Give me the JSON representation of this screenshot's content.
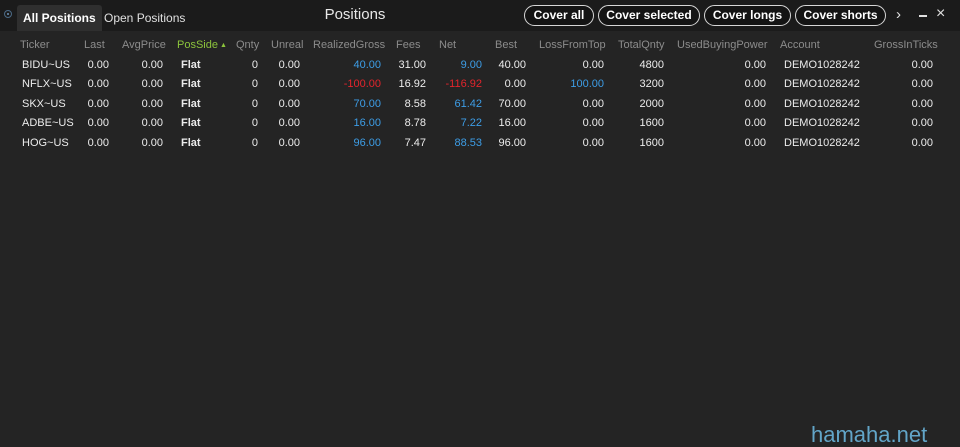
{
  "tabs": [
    "All Positions",
    "Open Positions"
  ],
  "window_title": "Positions",
  "buttons": [
    "Cover all",
    "Cover selected",
    "Cover longs",
    "Cover shorts"
  ],
  "columns": [
    "Ticker",
    "Last",
    "AvgPrice",
    "PosSide",
    "Qnty",
    "Unreal",
    "RealizedGross",
    "Fees",
    "Net",
    "Best",
    "LossFromTop",
    "TotalQnty",
    "UsedBuyingPower",
    "Account",
    "GrossInTicks"
  ],
  "sorted_column": "PosSide",
  "rows": [
    {
      "ticker": "BIDU~US",
      "last": "0.00",
      "avg_price": "0.00",
      "pos_side": "Flat",
      "qnty": "0",
      "unreal": "0.00",
      "realized_gross": "40.00",
      "fees": "31.00",
      "net": "9.00",
      "best": "40.00",
      "loss_from_top": "0.00",
      "total_qnty": "4800",
      "used_bp": "0.00",
      "account": "DEMO1028242",
      "gross_ticks": "0.00"
    },
    {
      "ticker": "NFLX~US",
      "last": "0.00",
      "avg_price": "0.00",
      "pos_side": "Flat",
      "qnty": "0",
      "unreal": "0.00",
      "realized_gross": "-100.00",
      "fees": "16.92",
      "net": "-116.92",
      "best": "0.00",
      "loss_from_top": "100.00",
      "total_qnty": "3200",
      "used_bp": "0.00",
      "account": "DEMO1028242",
      "gross_ticks": "0.00"
    },
    {
      "ticker": "SKX~US",
      "last": "0.00",
      "avg_price": "0.00",
      "pos_side": "Flat",
      "qnty": "0",
      "unreal": "0.00",
      "realized_gross": "70.00",
      "fees": "8.58",
      "net": "61.42",
      "best": "70.00",
      "loss_from_top": "0.00",
      "total_qnty": "2000",
      "used_bp": "0.00",
      "account": "DEMO1028242",
      "gross_ticks": "0.00"
    },
    {
      "ticker": "ADBE~US",
      "last": "0.00",
      "avg_price": "0.00",
      "pos_side": "Flat",
      "qnty": "0",
      "unreal": "0.00",
      "realized_gross": "16.00",
      "fees": "8.78",
      "net": "7.22",
      "best": "16.00",
      "loss_from_top": "0.00",
      "total_qnty": "1600",
      "used_bp": "0.00",
      "account": "DEMO1028242",
      "gross_ticks": "0.00"
    },
    {
      "ticker": "HOG~US",
      "last": "0.00",
      "avg_price": "0.00",
      "pos_side": "Flat",
      "qnty": "0",
      "unreal": "0.00",
      "realized_gross": "96.00",
      "fees": "7.47",
      "net": "88.53",
      "best": "96.00",
      "loss_from_top": "0.00",
      "total_qnty": "1600",
      "used_bp": "0.00",
      "account": "DEMO1028242",
      "gross_ticks": "0.00"
    }
  ],
  "colors": {
    "positive": "#3d9de6",
    "negative": "#e2242c",
    "sorted_header": "#8cc43c"
  },
  "icons": [
    "pin-icon",
    "chevron-right-icon",
    "minimize-icon",
    "close-icon",
    "sort-ascending-icon"
  ],
  "watermark": "hamaha.net"
}
